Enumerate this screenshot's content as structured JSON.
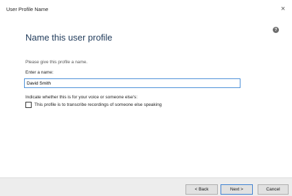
{
  "window": {
    "title": "User Profile Name",
    "close_glyph": "×"
  },
  "page": {
    "heading": "Name this user profile",
    "help_glyph": "?",
    "intro": "Please give this profile a name.",
    "name_label": "Enter a name:",
    "name_value": "David Smith",
    "voice_question": "Indicate whether this is for your voice or someone else's:",
    "checkbox_label": "This profile is to transcribe recordings of someone else speaking",
    "checkbox_checked": false
  },
  "buttons": {
    "back": "< Back",
    "next": "Next >",
    "cancel": "Cancel"
  }
}
